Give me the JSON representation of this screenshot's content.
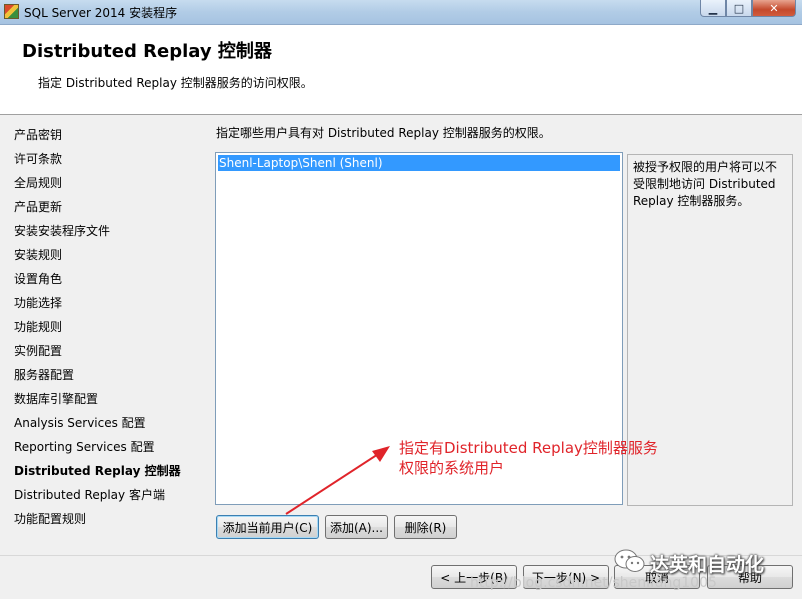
{
  "window": {
    "title": "SQL Server 2014 安装程序",
    "buttons": {
      "minimize": "▁",
      "maximize": "□",
      "close": "✕"
    }
  },
  "header": {
    "title": "Distributed  Replay 控制器",
    "subtitle": "指定 Distributed Replay 控制器服务的访问权限。"
  },
  "nav": {
    "items": [
      "产品密钥",
      "许可条款",
      "全局规则",
      "产品更新",
      "安装安装程序文件",
      "安装规则",
      "设置角色",
      "功能选择",
      "功能规则",
      "实例配置",
      "服务器配置",
      "数据库引擎配置",
      "Analysis Services 配置",
      "Reporting Services 配置",
      "Distributed Replay 控制器",
      "Distributed Replay 客户端",
      "功能配置规则"
    ],
    "active_index": 14
  },
  "main": {
    "instruction": "指定哪些用户具有对 Distributed Replay 控制器服务的权限。",
    "users": [
      "Shenl-Laptop\\Shenl (Shenl)"
    ],
    "help_text": "被授予权限的用户将可以不受限制地访问 Distributed Replay 控制器服务。",
    "buttons": {
      "add_current": "添加当前用户(C)",
      "add": "添加(A)...",
      "remove": "删除(R)"
    }
  },
  "annotation": {
    "line1": "指定有Distributed Replay控制器服务",
    "line2": "权限的系统用户",
    "color": "#e0242a"
  },
  "footer": {
    "back": "< 上一步(B)",
    "next": "下一步(N) >",
    "cancel": "取消",
    "help": "帮助"
  },
  "watermark": {
    "url": "http://blog.csdn.net/shenlfang1005",
    "brand": "达英和自动化"
  }
}
